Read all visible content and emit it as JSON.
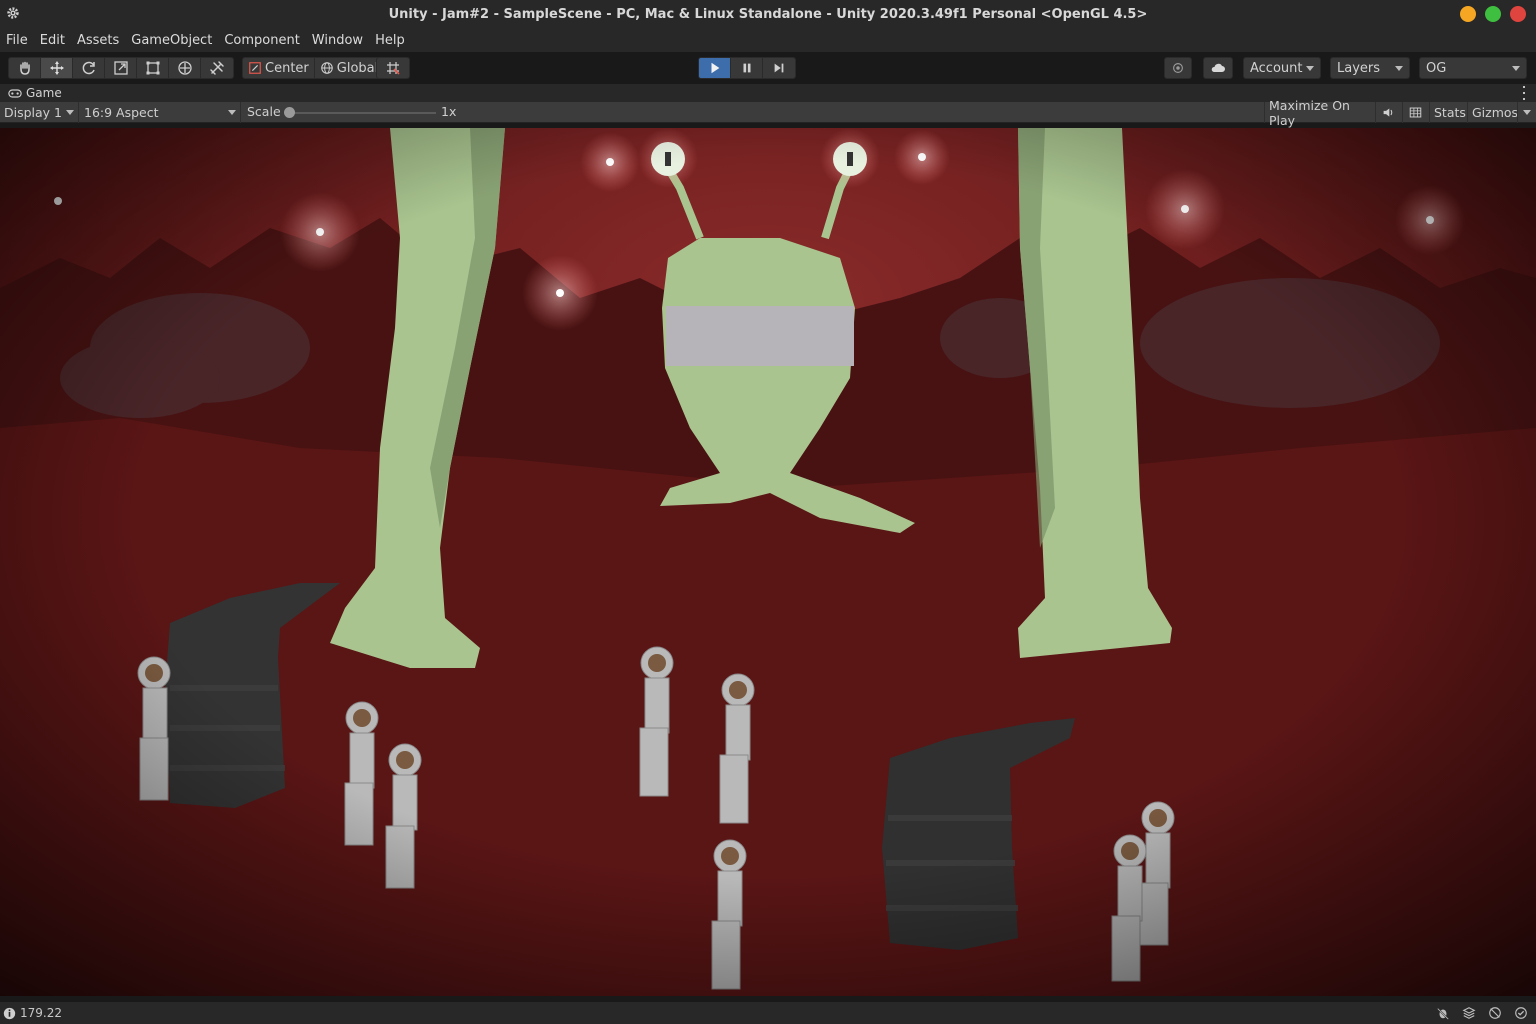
{
  "window": {
    "title": "Unity - Jam#2 - SampleScene - PC, Mac & Linux Standalone - Unity 2020.3.49f1 Personal <OpenGL 4.5>",
    "controls": [
      {
        "name": "minimize",
        "color": "#f5a623"
      },
      {
        "name": "maximize",
        "color": "#3fbf3f"
      },
      {
        "name": "close",
        "color": "#e0443e"
      }
    ]
  },
  "menu": {
    "items": [
      {
        "label": "File"
      },
      {
        "label": "Edit"
      },
      {
        "label": "Assets"
      },
      {
        "label": "GameObject"
      },
      {
        "label": "Component"
      },
      {
        "label": "Window"
      },
      {
        "label": "Help"
      }
    ]
  },
  "toolbar": {
    "transform_tools": [
      {
        "name": "hand-icon",
        "active": false
      },
      {
        "name": "move-icon",
        "active": true
      },
      {
        "name": "rotate-icon",
        "active": false
      },
      {
        "name": "scale-icon",
        "active": false
      },
      {
        "name": "rect-icon",
        "active": false
      },
      {
        "name": "transform-icon",
        "active": false
      },
      {
        "name": "custom-tool-icon",
        "active": false
      }
    ],
    "pivot_mode": "Center",
    "pivot_rotation": "Global",
    "account": "Account",
    "layers": "Layers",
    "layout": "OG",
    "play_accent": "#3e6dab"
  },
  "game_tab": {
    "label": "Game"
  },
  "game_bar": {
    "display": "Display 1",
    "aspect": "16:9 Aspect",
    "scale_label": "Scale",
    "scale_value": "1x",
    "maximize_on_play": "Maximize On Play",
    "stats": "Stats",
    "gizmos": "Gizmos"
  },
  "status": {
    "fps": "179.22"
  }
}
